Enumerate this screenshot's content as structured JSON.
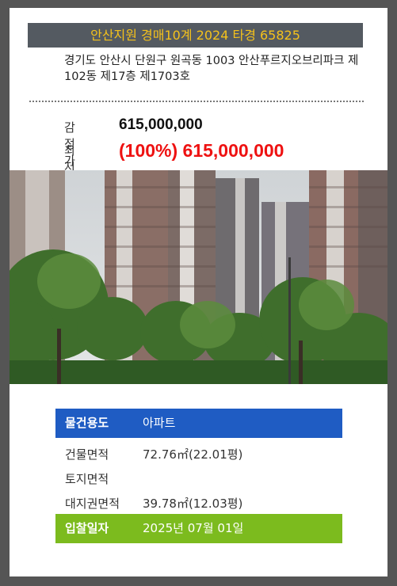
{
  "header": {
    "title": "안산지원 경매10계 2024 타경 65825"
  },
  "property": {
    "address": "경기도 안산시 단원구 원곡동 1003 안산푸르지오브리파크 제102동 제17층 제1703호"
  },
  "prices": {
    "appraised_label": "감정가",
    "appraised_value": "615,000,000",
    "minimum_label": "최저가",
    "minimum_value": "(100%) 615,000,000"
  },
  "details": {
    "usage_label": "물건용도",
    "usage_value": "아파트",
    "building_area_label": "건물면적",
    "building_area_value": "72.76㎡(22.01평)",
    "land_area_label": "토지면적",
    "land_area_value": "",
    "land_right_label": "대지권면적",
    "land_right_value": "39.78㎡(12.03평)",
    "bid_date_label": "입찰일자",
    "bid_date_value": "2025년 07월 01일"
  },
  "colors": {
    "header_bg": "#545a61",
    "header_text": "#f5c21b",
    "minimum_price": "#ee1111",
    "usage_bg": "#1f5cc3",
    "bid_bg": "#7cbb1e"
  }
}
